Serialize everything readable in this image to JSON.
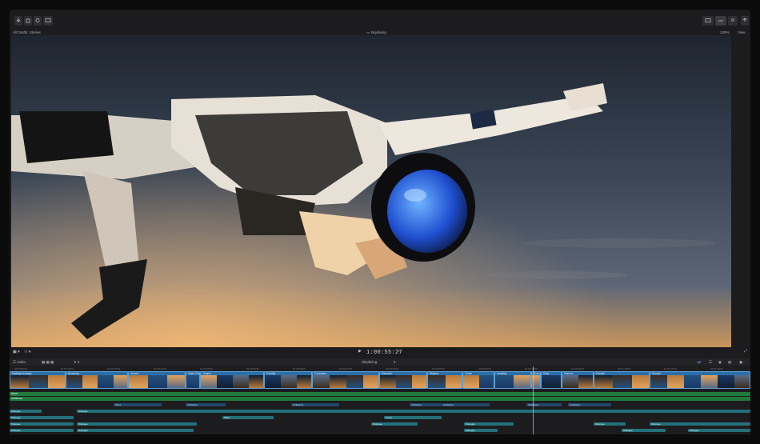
{
  "app": {
    "library_title": "All Drafts: Stories",
    "project_name": "Skydiving",
    "zoom": "100%",
    "view_label": "View"
  },
  "viewer": {
    "timecode": "1:00:55:27"
  },
  "timeline": {
    "index_label": "Index",
    "project_label": "Skydiving",
    "ruler": [
      "01:00:05:00",
      "01:00:10:00",
      "01:00:15:00",
      "01:00:20:00",
      "01:00:25:00",
      "01:00:30:00",
      "01:00:35:00",
      "01:00:40:00",
      "01:00:45:00",
      "01:00:50:00",
      "01:00:55:00",
      "01:01:00:00",
      "01:01:05:00",
      "01:01:10:00",
      "01:01:15:00",
      "01:01:20:00"
    ],
    "video_clips": [
      {
        "label": "Waiting for jump",
        "start": 0,
        "end": 70
      },
      {
        "label": "Boarding",
        "start": 70,
        "end": 148
      },
      {
        "label": "Ascent",
        "start": 148,
        "end": 220
      },
      {
        "label": "Open Door",
        "start": 220,
        "end": 238
      },
      {
        "label": "Jumper",
        "start": 238,
        "end": 318
      },
      {
        "label": "Freefall",
        "start": 318,
        "end": 378
      },
      {
        "label": "Formation",
        "start": 378,
        "end": 462
      },
      {
        "label": "Descent",
        "start": 462,
        "end": 522
      },
      {
        "label": "Skyline",
        "start": 522,
        "end": 566
      },
      {
        "label": "Chute",
        "start": 566,
        "end": 606
      },
      {
        "label": "Landing",
        "start": 606,
        "end": 652
      },
      {
        "label": "Sunset",
        "start": 652,
        "end": 664
      },
      {
        "label": "Gear",
        "start": 664,
        "end": 690
      },
      {
        "label": "Horizon",
        "start": 690,
        "end": 730
      },
      {
        "label": "Clouds",
        "start": 730,
        "end": 800
      },
      {
        "label": "Sunset",
        "start": 800,
        "end": 926
      }
    ],
    "green_rows": [
      {
        "label": "Music",
        "start": 0,
        "end": 926,
        "row": 0
      },
      {
        "label": "Wind",
        "start": 0,
        "end": 490,
        "row": 1
      },
      {
        "label": "Ambience",
        "start": 0,
        "end": 926,
        "row": 1
      }
    ],
    "audio_rows": [
      [
        {
          "label": "Wind",
          "start": 130,
          "end": 190
        },
        {
          "label": "Ambience",
          "start": 220,
          "end": 270
        },
        {
          "label": "Ambience",
          "start": 352,
          "end": 412
        },
        {
          "label": "Ambience",
          "start": 500,
          "end": 540
        },
        {
          "label": "Ambience",
          "start": 540,
          "end": 600
        },
        {
          "label": "Ambience",
          "start": 646,
          "end": 690
        },
        {
          "label": "Ambience",
          "start": 698,
          "end": 752
        }
      ]
    ],
    "teal_rows": [
      [
        {
          "label": "Dialogue",
          "start": 0,
          "end": 40
        },
        {
          "label": "Dialogue",
          "start": 84,
          "end": 926
        }
      ],
      [
        {
          "label": "Dialogue",
          "start": 0,
          "end": 80
        },
        {
          "label": "Wind",
          "start": 266,
          "end": 330
        },
        {
          "label": "Chute",
          "start": 468,
          "end": 540
        }
      ],
      [
        {
          "label": "Dialogue",
          "start": 0,
          "end": 80
        },
        {
          "label": "Dialogue",
          "start": 84,
          "end": 234
        },
        {
          "label": "Dialogue",
          "start": 452,
          "end": 510
        },
        {
          "label": "Dialogue",
          "start": 568,
          "end": 630
        },
        {
          "label": "Dialogue",
          "start": 730,
          "end": 770
        },
        {
          "label": "Dialogue",
          "start": 800,
          "end": 926
        }
      ],
      [
        {
          "label": "Dialogue",
          "start": 0,
          "end": 80
        },
        {
          "label": "Dialogue",
          "start": 84,
          "end": 230
        },
        {
          "label": "Dialogue",
          "start": 568,
          "end": 610
        },
        {
          "label": "Dialogue",
          "start": 765,
          "end": 820
        },
        {
          "label": "Dialogue",
          "start": 848,
          "end": 926
        }
      ],
      [
        {
          "label": "Dialogue",
          "start": 0,
          "end": 80
        },
        {
          "label": "Dialogue",
          "start": 84,
          "end": 340
        },
        {
          "label": "Dialogue",
          "start": 744,
          "end": 790
        },
        {
          "label": "Dialogue",
          "start": 800,
          "end": 850
        }
      ]
    ]
  },
  "colors": {
    "video_clip": "#2b6fa8",
    "green_clip": "#1f7a3c",
    "teal_clip": "#24707a",
    "navy_clip": "#23466a"
  }
}
